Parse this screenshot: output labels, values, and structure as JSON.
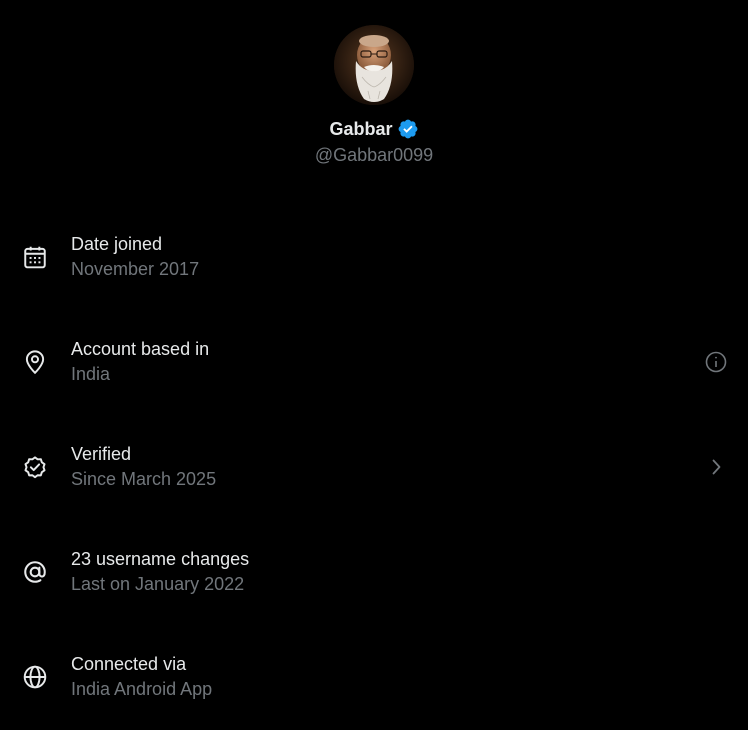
{
  "profile": {
    "display_name": "Gabbar",
    "handle": "@Gabbar0099",
    "verified_badge_color": "#1d9bf0"
  },
  "rows": [
    {
      "title": "Date joined",
      "subtitle": "November 2017",
      "icon": "calendar-icon"
    },
    {
      "title": "Account based in",
      "subtitle": "India",
      "icon": "location-pin-icon",
      "trailing_icon": "info-icon"
    },
    {
      "title": "Verified",
      "subtitle": "Since March 2025",
      "icon": "verified-check-icon",
      "trailing_icon": "chevron-right-icon"
    },
    {
      "title": "23 username changes",
      "subtitle": "Last on January 2022",
      "icon": "at-sign-icon"
    },
    {
      "title": "Connected via",
      "subtitle": "India Android App",
      "icon": "globe-icon"
    }
  ],
  "colors": {
    "background": "#000000",
    "primary_text": "#e7e9ea",
    "secondary_text": "#71767b",
    "accent": "#1d9bf0"
  }
}
